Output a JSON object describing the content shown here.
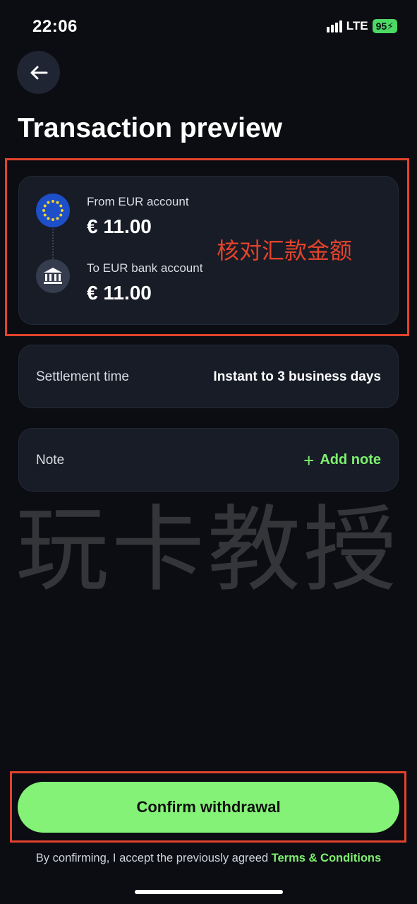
{
  "status_bar": {
    "time": "22:06",
    "network": "LTE",
    "battery": "95"
  },
  "page": {
    "title": "Transaction preview"
  },
  "transfer": {
    "from_label": "From EUR account",
    "from_amount": "€ 11.00",
    "to_label": "To EUR bank account",
    "to_amount": "€ 11.00",
    "from_icon": "eu-flag-icon",
    "to_icon": "bank-icon"
  },
  "annotation": "核对汇款金额",
  "settlement": {
    "label": "Settlement time",
    "value": "Instant to 3 business days"
  },
  "note": {
    "label": "Note",
    "add_label": "Add note"
  },
  "watermark": "玩卡教授",
  "confirm": {
    "label": "Confirm withdrawal"
  },
  "terms": {
    "prefix": "By confirming, I accept the previously agreed ",
    "link": "Terms & Conditions"
  },
  "colors": {
    "background": "#0b0d12",
    "card": "#171c26",
    "accent_green": "#83f276",
    "annotation_red": "#e2432c"
  }
}
